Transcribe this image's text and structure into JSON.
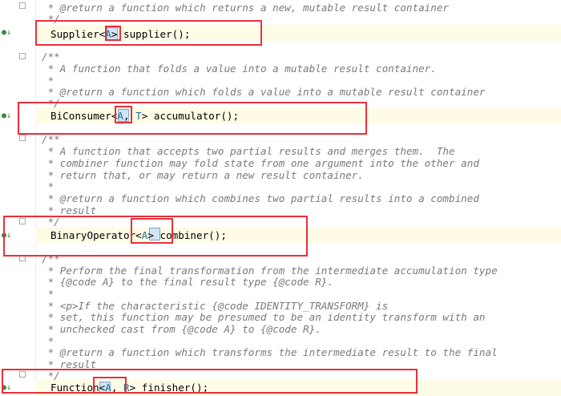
{
  "lines": {
    "l1": " * @return a function which returns a new, mutable result container",
    "l2": " */",
    "l3_pre": "Supplier<",
    "l3_tp": "A",
    "l3_post": "> supplier();",
    "l4": "/**",
    "l5": " * A function that folds a value into a mutable result container.",
    "l6": " *",
    "l7": " * @return a function which folds a value into a mutable result container",
    "l8": " */",
    "l9_pre": "BiConsumer<",
    "l9_tp": "A",
    "l9_mid": ", ",
    "l9_tp2": "T",
    "l9_post": "> accumulator();",
    "l10": "/**",
    "l11": " * A function that accepts two partial results and merges them.  The",
    "l12": " * combiner function may fold state from one argument into the other and",
    "l13": " * return that, or may return a new result container.",
    "l14": " *",
    "l15": " * @return a function which combines two partial results into a combined",
    "l16": " * result",
    "l17": " */",
    "l18_pre": "BinaryOperator<",
    "l18_tp": "A",
    "l18_post": "> combiner();",
    "l19": "/**",
    "l20": " * Perform the final transformation from the intermediate accumulation type",
    "l21": " * {@code A} to the final result type {@code R}.",
    "l22": " *",
    "l23": " * <p>If the characteristic {@code IDENTITY_TRANSFORM} is",
    "l24": " * set, this function may be presumed to be an identity transform with an",
    "l25": " * unchecked cast from {@code A} to {@code R}.",
    "l26": " *",
    "l27": " * @return a function which transforms the intermediate result to the final",
    "l28": " * result",
    "l29": " */",
    "l30_pre": "Function<",
    "l30_tp": "A",
    "l30_mid": ", ",
    "l30_tp2": "R",
    "l30_post": "> finisher();"
  },
  "gutter": {
    "marker": "●↓"
  }
}
